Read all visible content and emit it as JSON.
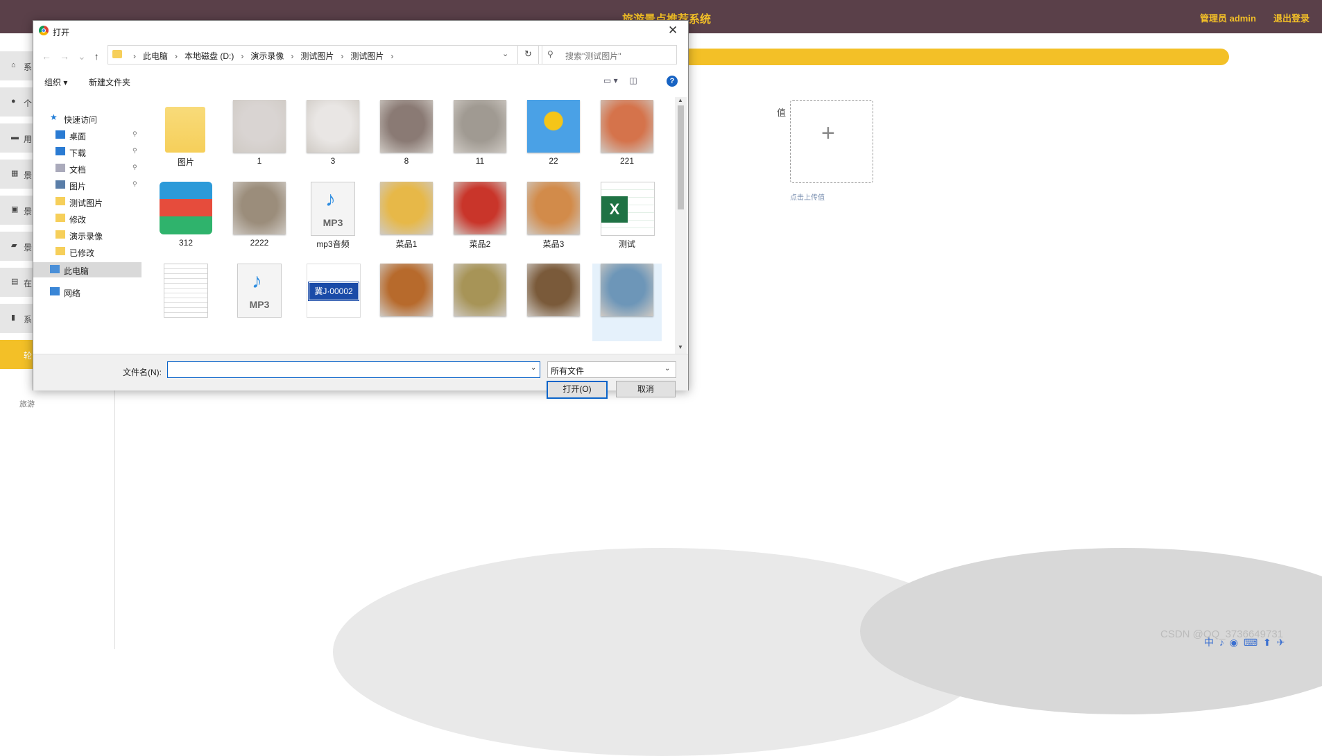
{
  "app": {
    "title": "旅游景点推荐系统",
    "user": "管理员 admin",
    "logout": "退出登录"
  },
  "sidebar": {
    "items": [
      {
        "icon": "home-icon",
        "label": "系"
      },
      {
        "icon": "user-icon",
        "label": "个"
      },
      {
        "icon": "folder-icon",
        "label": "用"
      },
      {
        "icon": "grid-icon",
        "label": "景"
      },
      {
        "icon": "bag-icon",
        "label": "景"
      },
      {
        "icon": "message-icon",
        "label": "景"
      },
      {
        "icon": "clipboard-icon",
        "label": "在"
      },
      {
        "icon": "chart-icon",
        "label": "系"
      },
      {
        "icon": "",
        "label": "轮"
      }
    ],
    "sub_label": "旅游"
  },
  "form": {
    "value_label": "值",
    "upload_hint": "点击上传值",
    "plus": "+"
  },
  "watermark": "CSDN @QQ_3736649731",
  "tray": "中 ♪ ◉ ⌨ ⬆ ✈",
  "dialog": {
    "title": "打开",
    "close": "✕",
    "breadcrumbs": [
      "此电脑",
      "本地磁盘 (D:)",
      "演示录像",
      "测试图片",
      "测试图片"
    ],
    "search_placeholder": "搜索\"测试图片\"",
    "toolbar": {
      "organize": "组织 ▾",
      "new_folder": "新建文件夹"
    },
    "nav": [
      {
        "label": "快速访问",
        "icon": "star-icon",
        "pinned": false
      },
      {
        "label": "桌面",
        "icon": "desktop-icon",
        "pinned": true
      },
      {
        "label": "下载",
        "icon": "download-icon",
        "pinned": true
      },
      {
        "label": "文档",
        "icon": "document-icon",
        "pinned": true
      },
      {
        "label": "图片",
        "icon": "picture-icon",
        "pinned": true
      },
      {
        "label": "测试图片",
        "icon": "folder-icon",
        "pinned": false
      },
      {
        "label": "修改",
        "icon": "folder-icon",
        "pinned": false
      },
      {
        "label": "演示录像",
        "icon": "folder-icon",
        "pinned": false
      },
      {
        "label": "已修改",
        "icon": "folder-icon",
        "pinned": false
      },
      {
        "label": "此电脑",
        "icon": "computer-icon",
        "pinned": false
      },
      {
        "label": "网络",
        "icon": "network-icon",
        "pinned": false
      }
    ],
    "files": [
      {
        "name": "图片",
        "kind": "folder",
        "color": "#f6cf5a"
      },
      {
        "name": "1",
        "kind": "photo",
        "color": "#d9d4d2"
      },
      {
        "name": "3",
        "kind": "photo",
        "color": "#e9e6e4"
      },
      {
        "name": "8",
        "kind": "photo",
        "color": "#8a7a74"
      },
      {
        "name": "11",
        "kind": "photo",
        "color": "#a09a92"
      },
      {
        "name": "22",
        "kind": "photo",
        "color": "#4aa1e6"
      },
      {
        "name": "221",
        "kind": "photo",
        "color": "#d5734b"
      },
      {
        "name": "312",
        "kind": "archive",
        "color": "#2c9ad9"
      },
      {
        "name": "2222",
        "kind": "photo",
        "color": "#9b8d7b"
      },
      {
        "name": "mp3音频",
        "kind": "mp3",
        "color": "#2f8de0"
      },
      {
        "name": "菜品1",
        "kind": "photo",
        "color": "#e7b848"
      },
      {
        "name": "菜品2",
        "kind": "photo",
        "color": "#c9352a"
      },
      {
        "name": "菜品3",
        "kind": "photo",
        "color": "#d28b4a"
      },
      {
        "name": "测试",
        "kind": "excel",
        "color": "#1f7244"
      },
      {
        "name": "",
        "kind": "text",
        "color": "#f2f2f2"
      },
      {
        "name": "",
        "kind": "mp3",
        "color": "#2f8de0"
      },
      {
        "name": "",
        "kind": "plate",
        "color": "#1a4ba8"
      },
      {
        "name": "",
        "kind": "photo",
        "color": "#b76a2c"
      },
      {
        "name": "",
        "kind": "photo",
        "color": "#a79457"
      },
      {
        "name": "",
        "kind": "photo",
        "color": "#7a5a3a"
      },
      {
        "name": "",
        "kind": "photo",
        "color": "#6d96b8"
      }
    ],
    "plate_text": "冀J·00002",
    "mp3_text": "MP3",
    "filename_label": "文件名(N):",
    "filename_value": "",
    "filetype": "所有文件",
    "open_button": "打开(O)",
    "cancel_button": "取消"
  }
}
